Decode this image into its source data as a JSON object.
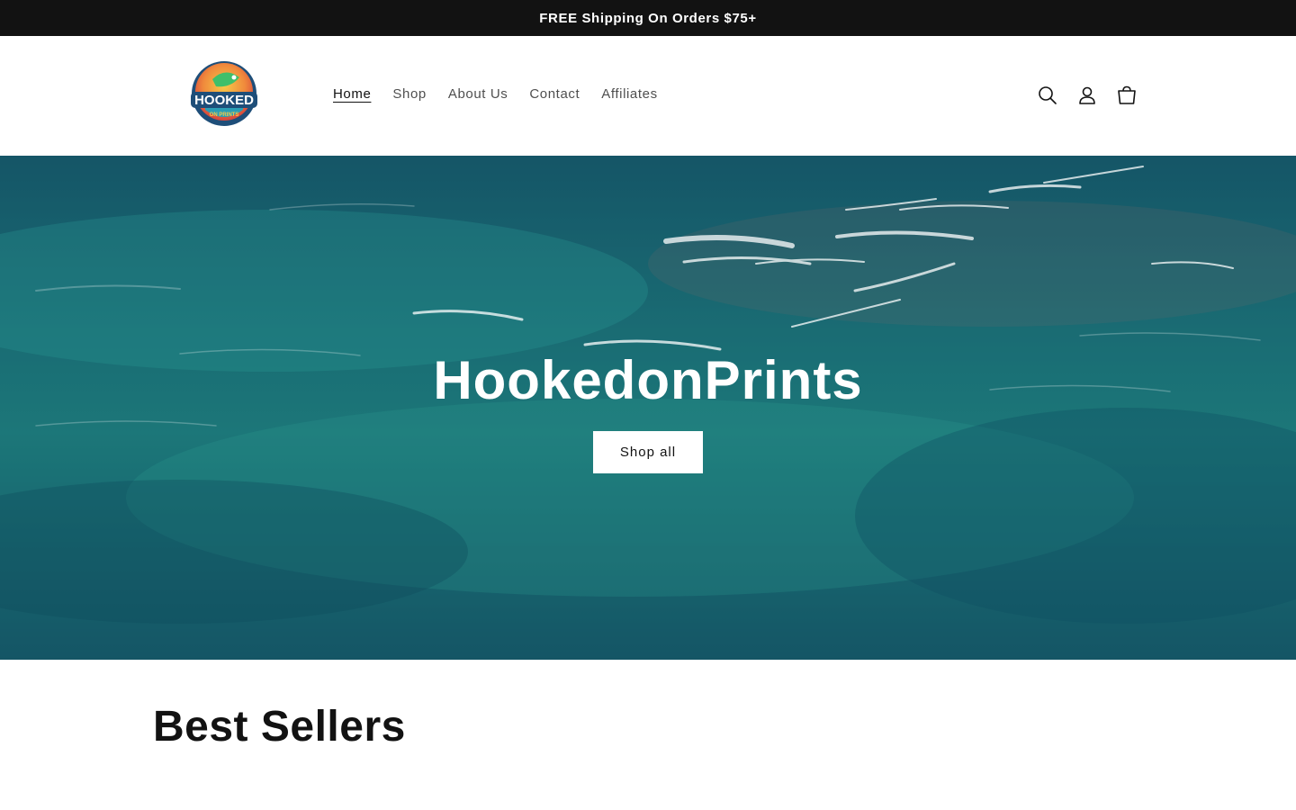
{
  "announcement": {
    "text": "FREE Shipping On Orders $75+"
  },
  "header": {
    "logo": {
      "text_main": "HOOKED",
      "text_sub": "ON PRINTS"
    },
    "nav": [
      {
        "label": "Home",
        "active": true
      },
      {
        "label": "Shop"
      },
      {
        "label": "About Us"
      },
      {
        "label": "Contact"
      },
      {
        "label": "Affiliates"
      }
    ],
    "icons": [
      "search-icon",
      "account-icon",
      "cart-icon"
    ]
  },
  "hero": {
    "title": "HookedonPrints",
    "button_label": "Shop all"
  },
  "section": {
    "title": "Best Sellers"
  },
  "colors": {
    "announcement_bg": "#121212",
    "text": "#121212",
    "hero_sea": "#1a6a72",
    "button_bg": "#ffffff"
  }
}
